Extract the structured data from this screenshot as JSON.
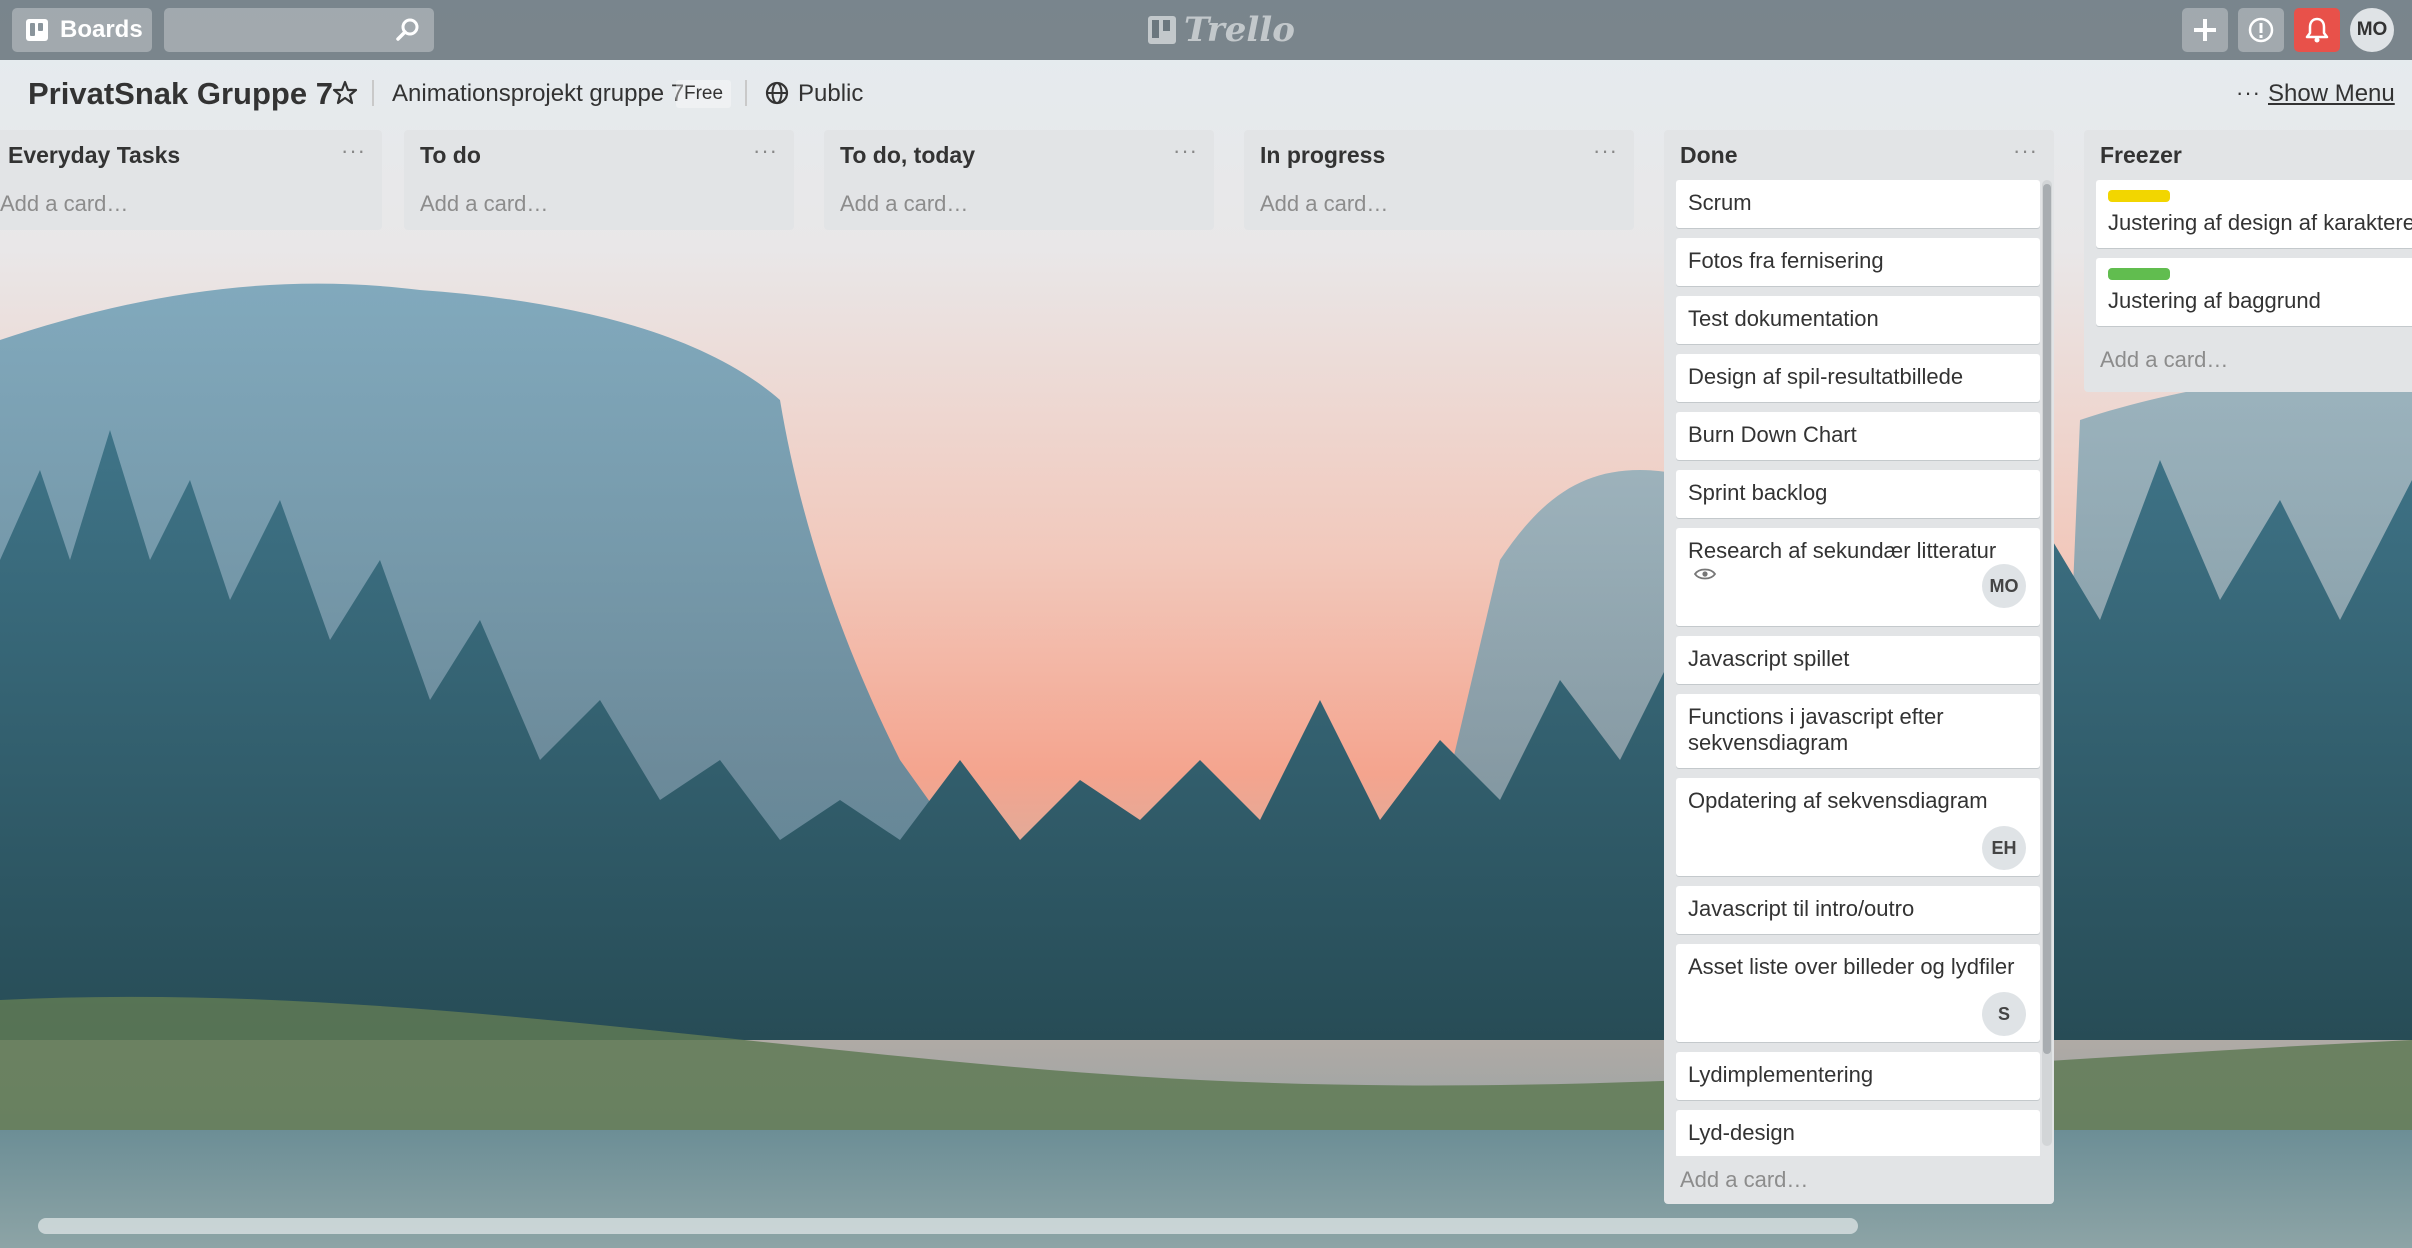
{
  "header": {
    "boards_label": "Boards",
    "search_value": "",
    "logo_text": "Trello",
    "avatar_initials": "MO"
  },
  "board": {
    "title": "PrivatSnak Gruppe 7",
    "team": "Animationsprojekt gruppe 7",
    "plan_badge": "Free",
    "visibility": "Public",
    "more_label": "···",
    "show_menu_label": "Show Menu"
  },
  "lists": [
    {
      "name": "Everyday Tasks",
      "add_card": "Add a card…"
    },
    {
      "name": "To do",
      "add_card": "Add a card…"
    },
    {
      "name": "To do, today",
      "add_card": "Add a card…"
    },
    {
      "name": "In progress",
      "add_card": "Add a card…"
    },
    {
      "name": "Done",
      "add_card": "Add a card…",
      "cards": [
        "Scrum",
        "Fotos fra fernisering",
        "Test dokumentation",
        "Design af spil-resultatbillede",
        "Burn Down Chart",
        "Sprint backlog",
        "Research af sekundær litteratur",
        "Javascript spillet",
        "Functions i javascript efter sekvensdiagram",
        "Opdatering af sekvensdiagram",
        "Javascript til intro/outro",
        "Asset liste over billeder og lydfiler",
        "Lydimplementering",
        "Lyd-design"
      ],
      "members": {
        "research": "MO",
        "opdatering": "EH",
        "asset": "S"
      }
    },
    {
      "name": "Freezer",
      "add_card": "Add a card…",
      "cards": [
        {
          "title": "Justering af design af karaktere",
          "label_color": "#f2d600"
        },
        {
          "title": "Justering af baggrund",
          "label_color": "#61bd4f"
        }
      ]
    }
  ],
  "list_menu_label": "···",
  "colors": {
    "header": "#626e76",
    "list_bg": "#e2e4e6",
    "notification": "#e8514a"
  }
}
